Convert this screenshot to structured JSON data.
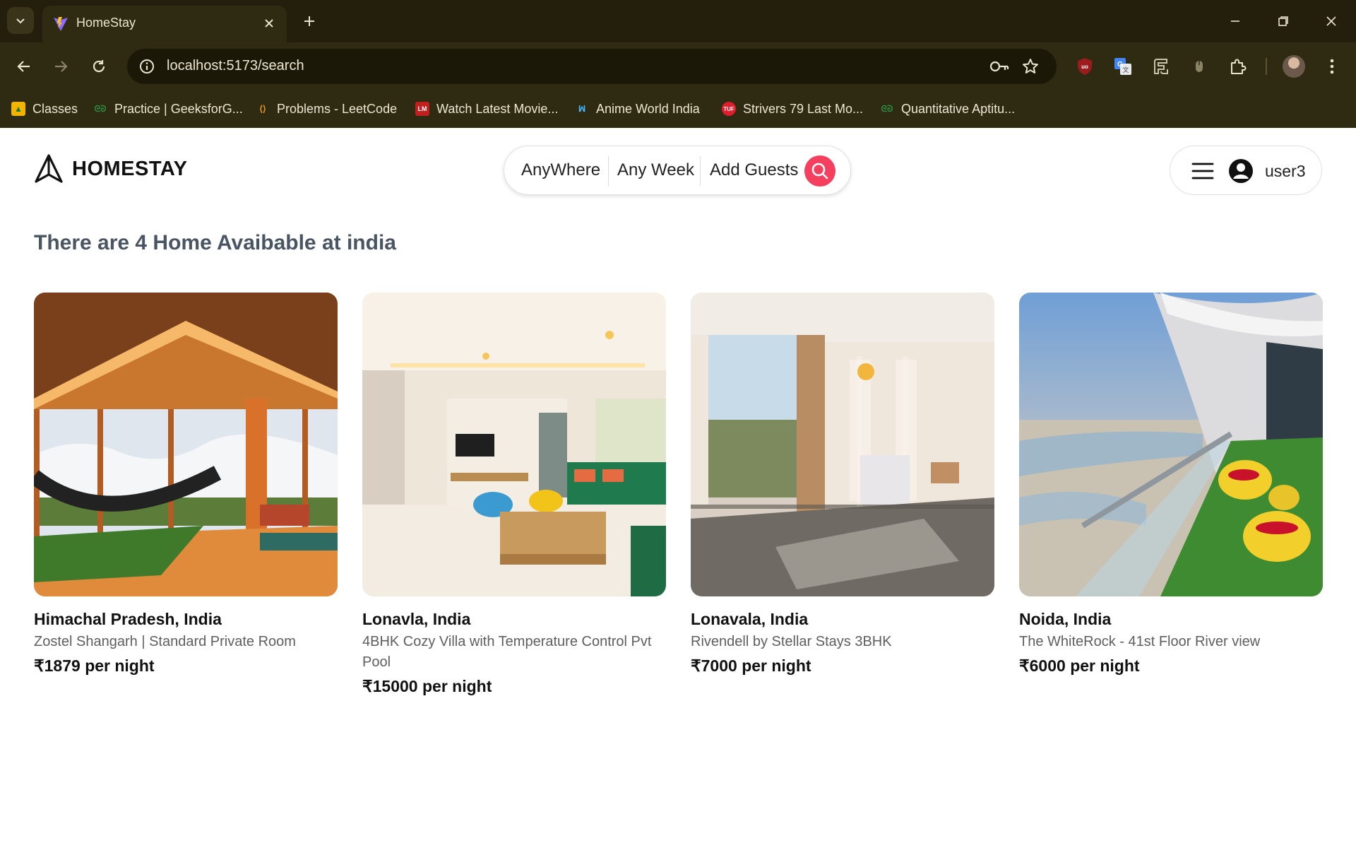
{
  "browser": {
    "tab_title": "HomeStay",
    "url": "localhost:5173/search",
    "bookmarks": [
      {
        "label": "Classes",
        "icon": "classroom-icon"
      },
      {
        "label": "Practice | GeeksforG...",
        "icon": "geeksforgeeks-icon"
      },
      {
        "label": "Problems - LeetCode",
        "icon": "leetcode-icon"
      },
      {
        "label": "Watch Latest Movie...",
        "icon": "movie-site-icon"
      },
      {
        "label": "Anime World India",
        "icon": "anime-world-icon"
      },
      {
        "label": "Strivers 79 Last Mo...",
        "icon": "tuf-icon"
      },
      {
        "label": "Quantitative Aptitu...",
        "icon": "geeksforgeeks-icon"
      }
    ]
  },
  "header": {
    "logo_text": "HOMESTAY",
    "search": {
      "where": "AnyWhere",
      "when": "Any Week",
      "guests": "Add Guests"
    },
    "user": {
      "name": "user3"
    }
  },
  "results": {
    "heading": "There are 4 Home Avaibable at india",
    "listings": [
      {
        "location": "Himachal Pradesh, India",
        "title": "Zostel Shangarh | Standard Private Room",
        "price": "₹1879 per night"
      },
      {
        "location": "Lonavla, India",
        "title": "4BHK Cozy Villa with Temperature Control Pvt Pool",
        "price": "₹15000 per night"
      },
      {
        "location": "Lonavala, India",
        "title": "Rivendell by Stellar Stays 3BHK",
        "price": "₹7000 per night"
      },
      {
        "location": "Noida, India",
        "title": "The WhiteRock - 41st Floor River view",
        "price": "₹6000 per night"
      }
    ]
  },
  "colors": {
    "accent": "#f43f5e",
    "chrome_bg": "#2f2a12",
    "heading_text": "#4a5563"
  }
}
